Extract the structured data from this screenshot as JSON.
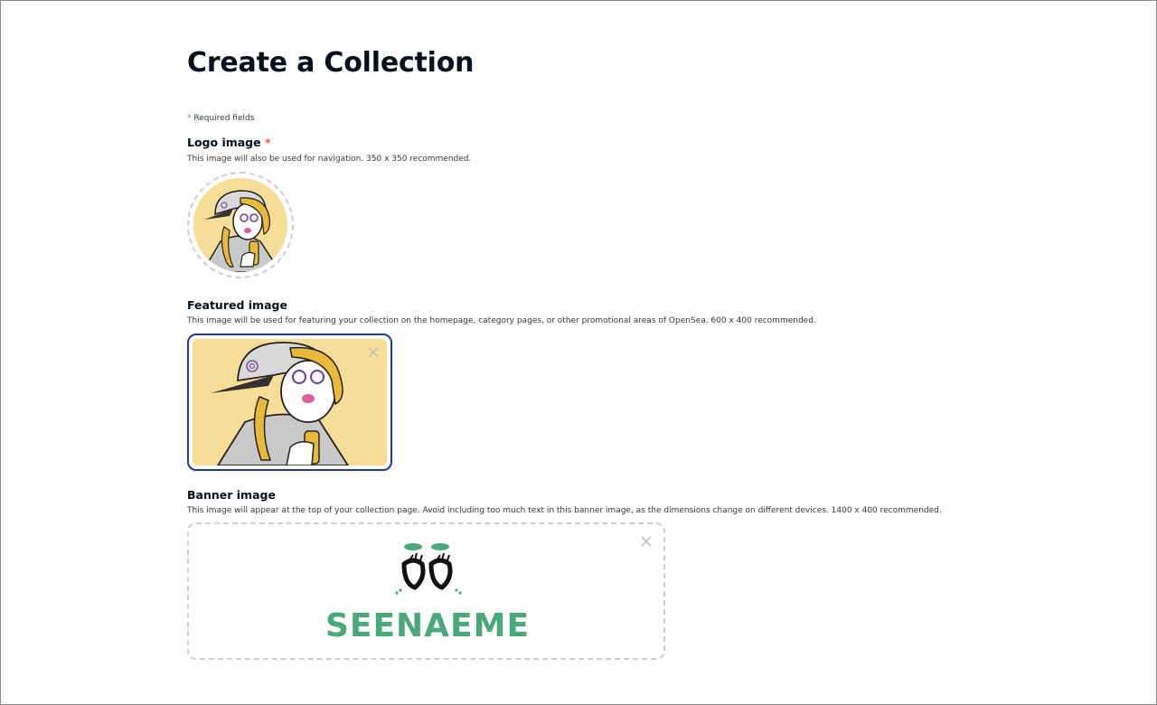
{
  "page": {
    "title": "Create a Collection",
    "required_note": "Required fields",
    "required_marker": "*"
  },
  "logo": {
    "label": "Logo image",
    "required_marker": "*",
    "description": "This image will also be used for navigation. 350 x 350 recommended."
  },
  "featured": {
    "label": "Featured image",
    "description": "This image will be used for featuring your collection on the homepage, category pages, or other promotional areas of OpenSea. 600 x 400 recommended."
  },
  "banner": {
    "label": "Banner image",
    "description": "This image will appear at the top of your collection page. Avoid including too much text in this banner image, as the dimensions change on different devices. 1400 x 400 recommended.",
    "artwork_text": "SEENAEME"
  },
  "icons": {
    "close": "close-icon"
  },
  "colors": {
    "required_star": "#eb5757",
    "featured_border": "#1e3c96",
    "banner_text": "#4aa97a",
    "artwork_background": "#f7dd95"
  }
}
